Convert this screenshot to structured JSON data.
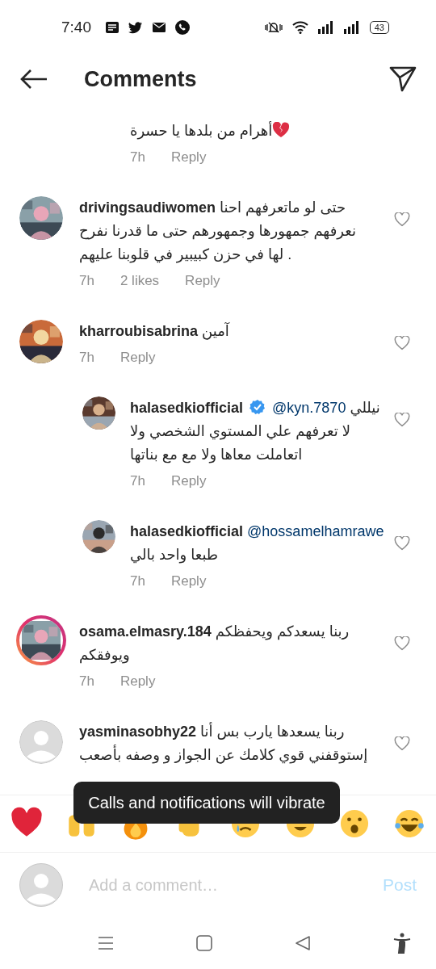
{
  "status_bar": {
    "time": "7:40",
    "battery": "43"
  },
  "header": {
    "title": "Comments"
  },
  "comments": [
    {
      "replies": [
        {
          "text": "أهرام من بلدها يا حسرة",
          "broken_heart": true,
          "time": "7h",
          "reply_label": "Reply"
        }
      ]
    },
    {
      "username": "drivingsaudiwomen",
      "verified": false,
      "story": false,
      "text": "حتى لو ماتعرفهم  احنا نعرفهم جمهورها وجمهورهم حتى ما قدرنا نفرح لها  في حزن كبيبير في قلوبنا عليهم .",
      "time": "7h",
      "likes": "2 likes",
      "reply_label": "Reply",
      "liked": false
    },
    {
      "username": "kharroubisabrina",
      "verified": false,
      "story": false,
      "text": "آمين",
      "time": "7h",
      "reply_label": "Reply",
      "liked": false,
      "replies": [
        {
          "username": "halasedkiofficial",
          "verified": true,
          "story": false,
          "mention": "@kyn.7870",
          "text": "نيللي لا تعرفهم علي المستوي الشخصي ولا اتعاملت معاها ولا مع مع بناتها",
          "time": "7h",
          "reply_label": "Reply",
          "liked": false
        },
        {
          "username": "halasedkiofficial",
          "verified": false,
          "story": false,
          "mention": "@hossamelhamrawe",
          "text": "طبعا واحد بالي",
          "time": "7h",
          "reply_label": "Reply",
          "liked": false
        }
      ]
    },
    {
      "username": "osama.elmasry.184",
      "verified": false,
      "story": true,
      "text": "ربنا يسعدكم ويحفظكم ويوفقكم",
      "time": "7h",
      "reply_label": "Reply",
      "liked": false
    },
    {
      "username": "yasminasobhy22",
      "verified": false,
      "avatar": {
        "kind": "default"
      },
      "story": false,
      "text": "ربنا يسعدها يارب بس أنا إستوقفني قوي كلامك عن الجواز و وصفه بأصعب",
      "liked": false
    }
  ],
  "toast": "Calls and notifications will vibrate",
  "composer": {
    "placeholder": "Add a comment…",
    "post": "Post",
    "post_disabled": true
  }
}
